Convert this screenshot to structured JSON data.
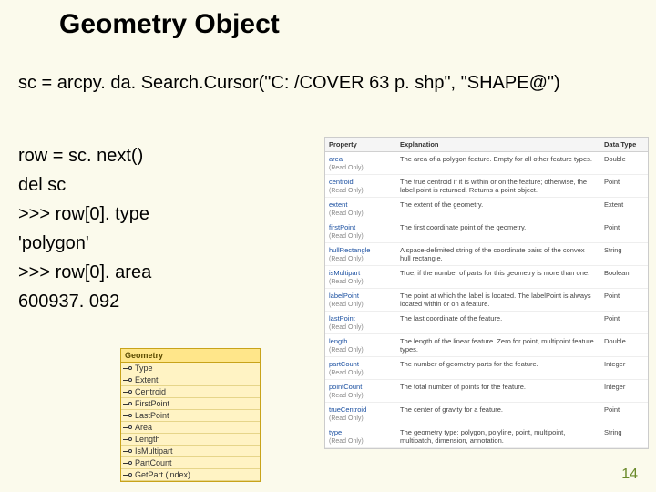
{
  "title": "Geometry Object",
  "code_top": "sc = arcpy. da. Search.Cursor(\"C: /COVER 63 p. shp\", \"SHAPE@\")",
  "code_left": "row = sc. next()\ndel sc\n>>> row[0]. type\n'polygon'\n>>> row[0]. area\n600937. 092",
  "table": {
    "headers": [
      "Property",
      "Explanation",
      "Data Type"
    ],
    "rows": [
      {
        "prop": "area",
        "sub": "(Read Only)",
        "exp": "The area of a polygon feature. Empty for all other feature types.",
        "type": "Double"
      },
      {
        "prop": "centroid",
        "sub": "(Read Only)",
        "exp": "The true centroid if it is within or on the feature; otherwise, the label point is returned. Returns a point object.",
        "type": "Point"
      },
      {
        "prop": "extent",
        "sub": "(Read Only)",
        "exp": "The extent of the geometry.",
        "type": "Extent"
      },
      {
        "prop": "firstPoint",
        "sub": "(Read Only)",
        "exp": "The first coordinate point of the geometry.",
        "type": "Point"
      },
      {
        "prop": "hullRectangle",
        "sub": "(Read Only)",
        "exp": "A space-delimited string of the coordinate pairs of the convex hull rectangle.",
        "type": "String"
      },
      {
        "prop": "isMultipart",
        "sub": "(Read Only)",
        "exp": "True, if the number of parts for this geometry is more than one.",
        "type": "Boolean"
      },
      {
        "prop": "labelPoint",
        "sub": "(Read Only)",
        "exp": "The point at which the label is located. The labelPoint is always located within or on a feature.",
        "type": "Point"
      },
      {
        "prop": "lastPoint",
        "sub": "(Read Only)",
        "exp": "The last coordinate of the feature.",
        "type": "Point"
      },
      {
        "prop": "length",
        "sub": "(Read Only)",
        "exp": "The length of the linear feature. Zero for point, multipoint feature types.",
        "type": "Double"
      },
      {
        "prop": "partCount",
        "sub": "(Read Only)",
        "exp": "The number of geometry parts for the feature.",
        "type": "Integer"
      },
      {
        "prop": "pointCount",
        "sub": "(Read Only)",
        "exp": "The total number of points for the feature.",
        "type": "Integer"
      },
      {
        "prop": "trueCentroid",
        "sub": "(Read Only)",
        "exp": "The center of gravity for a feature.",
        "type": "Point"
      },
      {
        "prop": "type",
        "sub": "(Read Only)",
        "exp": "The geometry type: polygon, polyline, point, multipoint, multipatch, dimension, annotation.",
        "type": "String"
      }
    ]
  },
  "geom": {
    "title": "Geometry",
    "items": [
      "Type",
      "Extent",
      "Centroid",
      "FirstPoint",
      "LastPoint",
      "Area",
      "Length",
      "IsMultipart",
      "PartCount",
      "GetPart (index)"
    ]
  },
  "page": "14"
}
